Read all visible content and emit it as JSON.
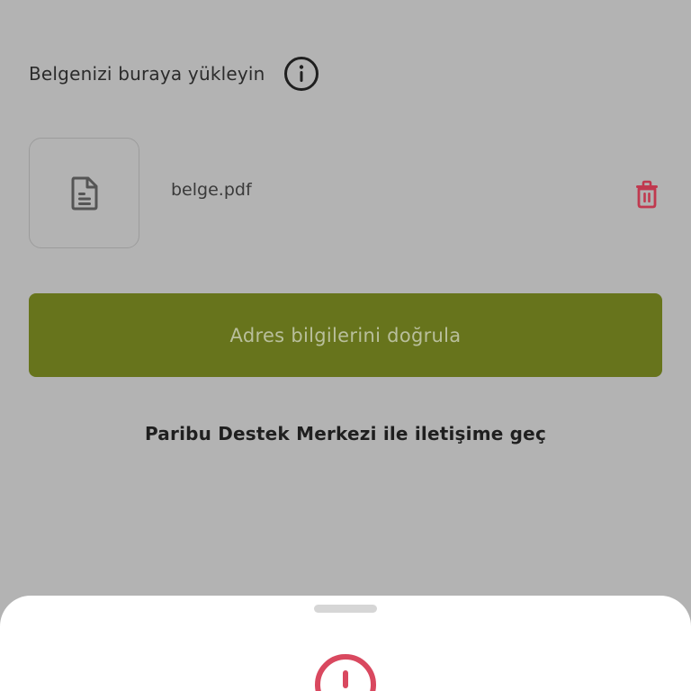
{
  "upload": {
    "label": "Belgenizi buraya yükleyin",
    "info_icon": "info-circle-icon"
  },
  "file": {
    "name": "belge.pdf",
    "thumb_icon": "document-icon",
    "delete_icon": "trash-icon"
  },
  "actions": {
    "verify_label": "Adres bilgilerini doğrula",
    "support_label": "Paribu Destek Merkezi ile iletişime geç"
  },
  "sheet": {
    "alert_icon": "alert-circle-icon"
  },
  "colors": {
    "overlay_bg": "#b3b3b3",
    "primary": "#67741c",
    "danger": "#d9485f",
    "text": "#2b2b2b"
  }
}
